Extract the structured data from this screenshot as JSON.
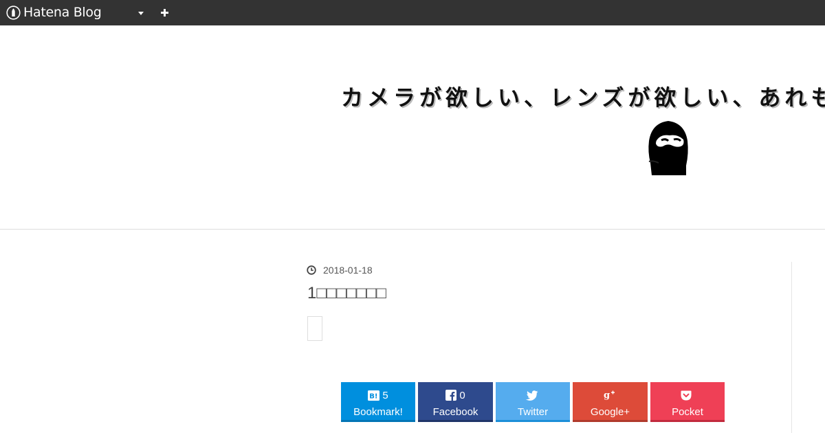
{
  "topbar": {
    "brand_label": "Hatena Blog",
    "brand_icon": "hatena-pen-icon",
    "menu_icon": "caret-down-icon",
    "add_icon": "plus-icon",
    "background": "#333333"
  },
  "header": {
    "blog_title": "カメラが欲しい、レンズが欲しい、あれも",
    "avatar_icon": "masked-face-avatar"
  },
  "article": {
    "date": "2018-01-18",
    "date_icon": "clock-icon",
    "title": "1□□□□□□□"
  },
  "share": [
    {
      "label": "Bookmark!",
      "count": "5",
      "icon": "hatena-bookmark-icon",
      "color": "#008fde"
    },
    {
      "label": "Facebook",
      "count": "0",
      "icon": "facebook-icon",
      "color": "#2e4a8d"
    },
    {
      "label": "Twitter",
      "count": "",
      "icon": "twitter-icon",
      "color": "#55acee"
    },
    {
      "label": "Google+",
      "count": "",
      "icon": "google-plus-icon",
      "color": "#dd4b39"
    },
    {
      "label": "Pocket",
      "count": "",
      "icon": "pocket-icon",
      "color": "#ef4056"
    }
  ]
}
